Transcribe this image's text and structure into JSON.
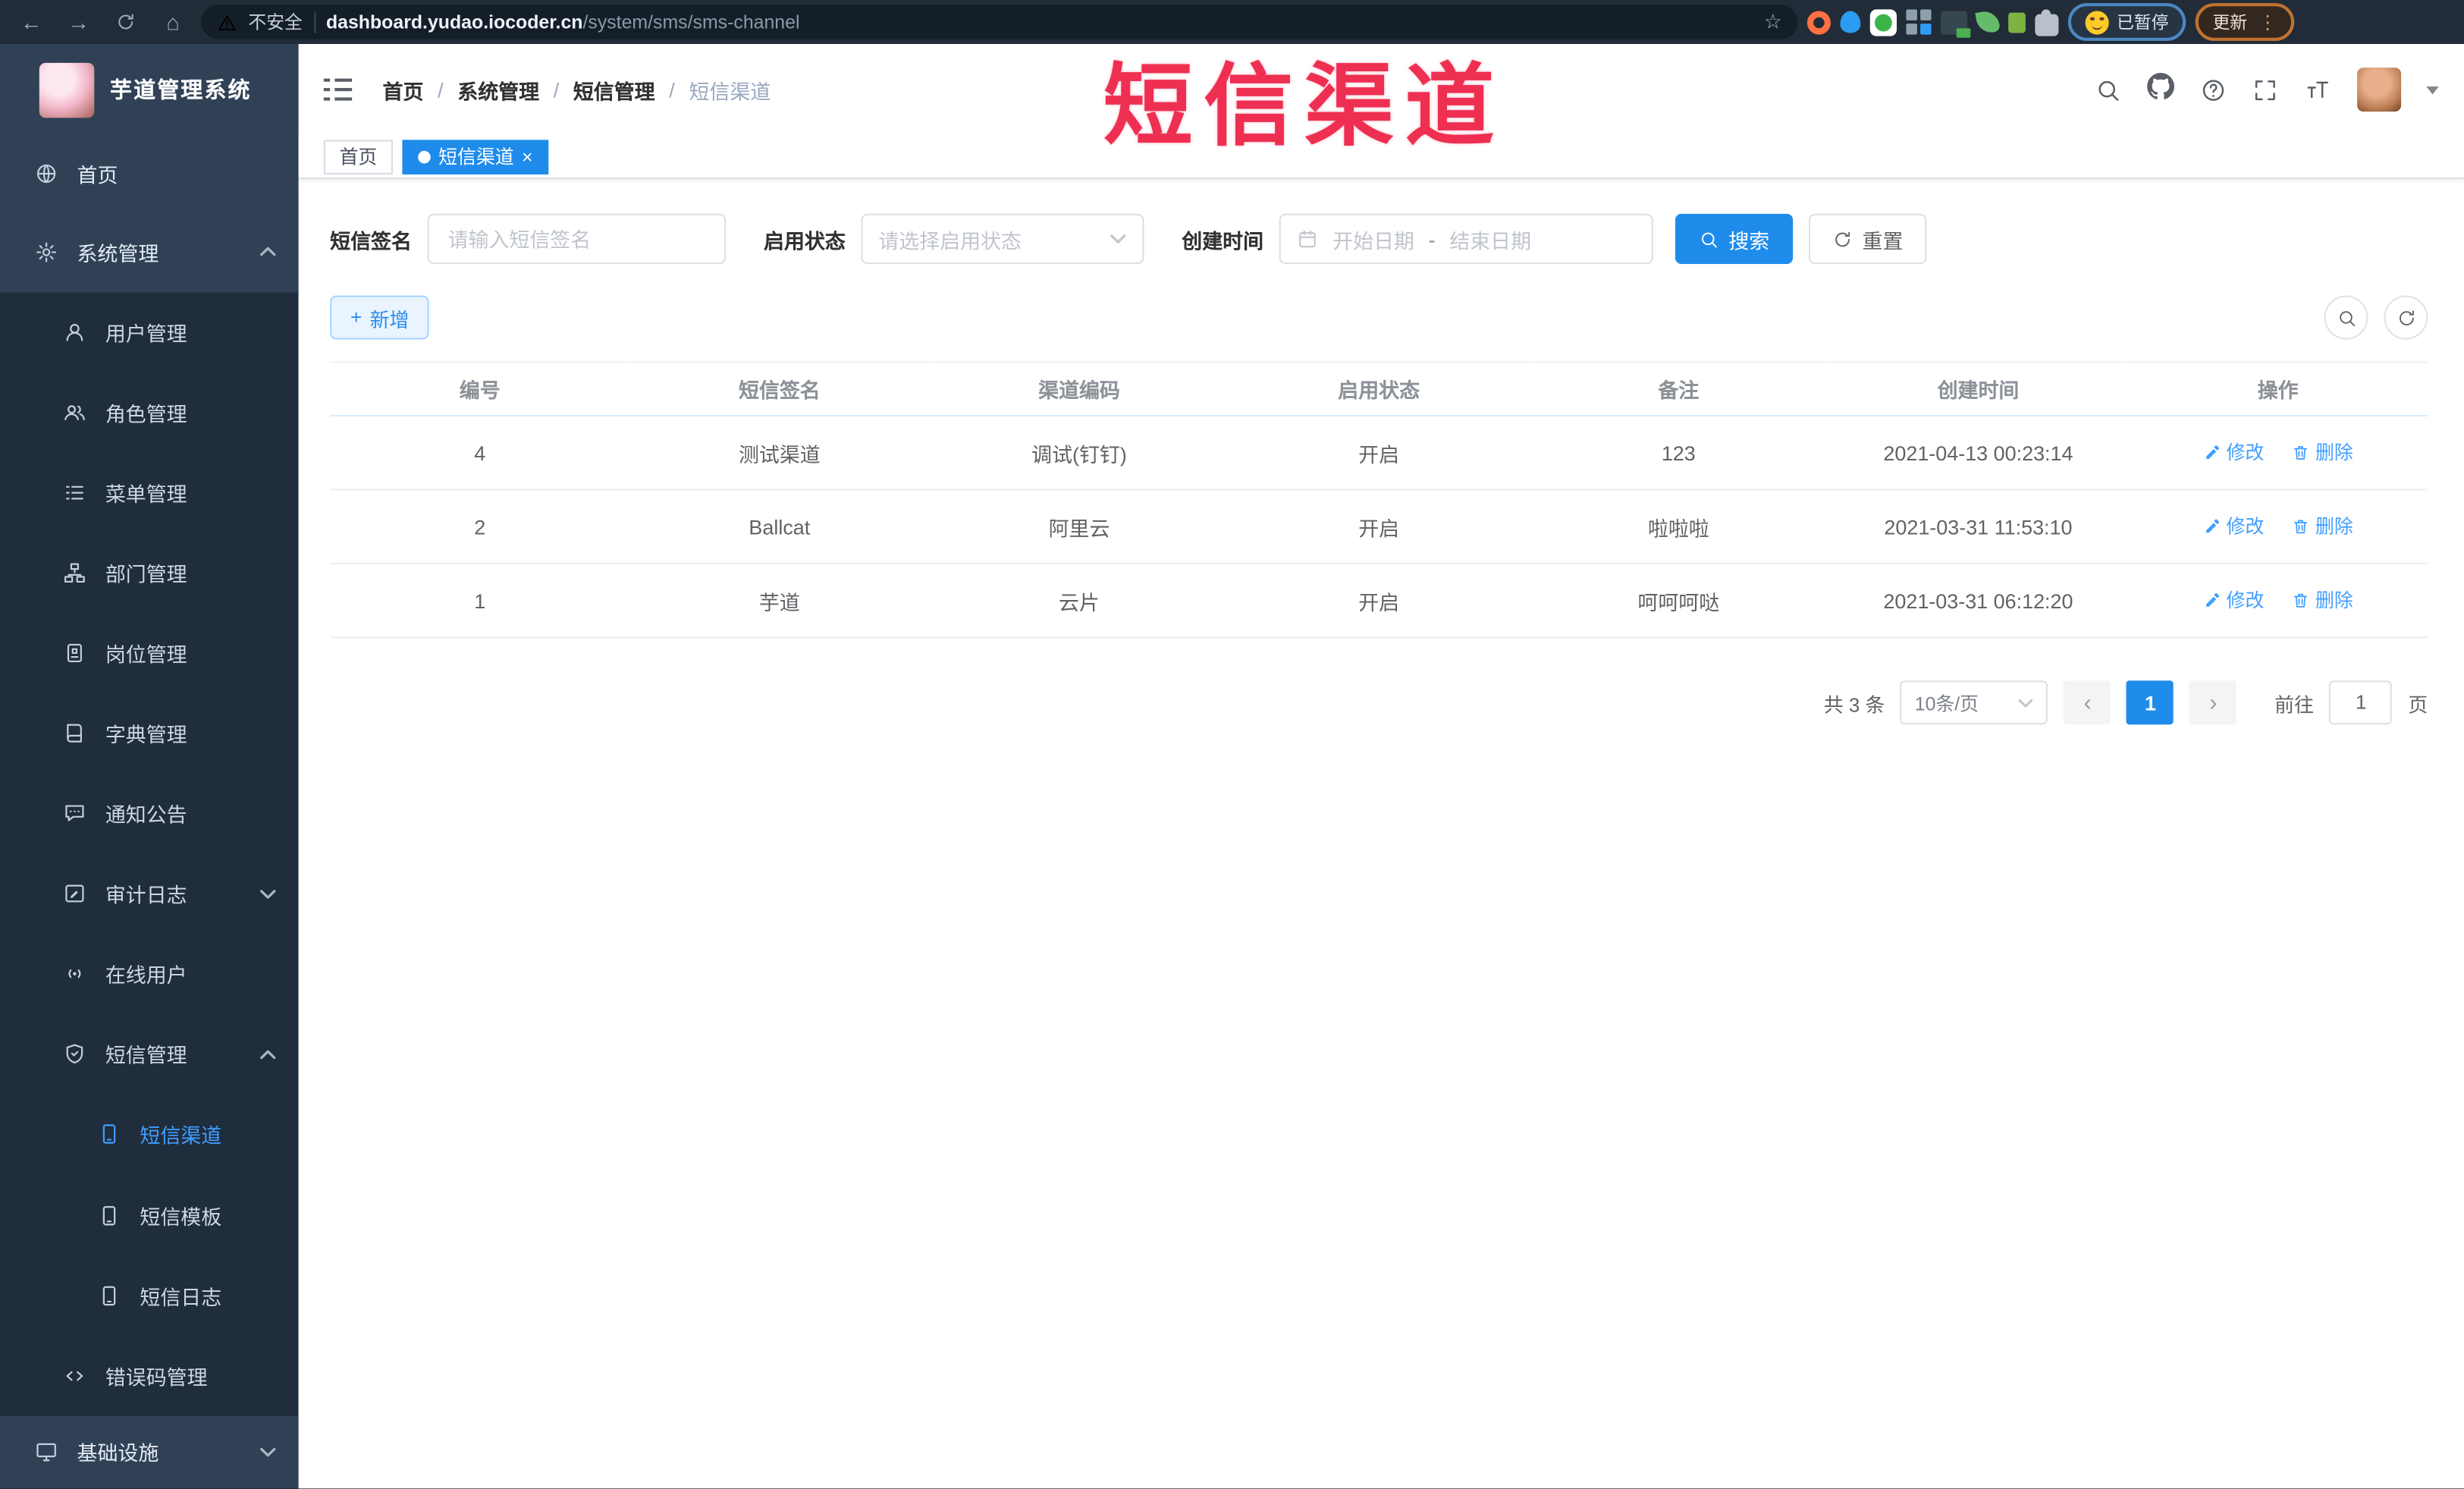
{
  "browser": {
    "security_warning": "不安全",
    "url_domain": "dashboard.yudao.iocoder.cn",
    "url_path": "/system/sms/sms-channel",
    "profile_label": "已暂停",
    "update_label": "更新"
  },
  "icons": {
    "back_arrow": "←",
    "forward_arrow": "→",
    "home": "⌂",
    "bookmark_star": "☆",
    "kebab": "⋮",
    "plus": "+",
    "close": "×",
    "prev": "‹",
    "next": "›"
  },
  "overlay_title": "短信渠道",
  "sidebar": {
    "logo_title": "芋道管理系统",
    "items": [
      {
        "label": "首页"
      },
      {
        "label": "系统管理"
      },
      {
        "label": "用户管理"
      },
      {
        "label": "角色管理"
      },
      {
        "label": "菜单管理"
      },
      {
        "label": "部门管理"
      },
      {
        "label": "岗位管理"
      },
      {
        "label": "字典管理"
      },
      {
        "label": "通知公告"
      },
      {
        "label": "审计日志"
      },
      {
        "label": "在线用户"
      },
      {
        "label": "短信管理"
      },
      {
        "label": "短信渠道"
      },
      {
        "label": "短信模板"
      },
      {
        "label": "短信日志"
      },
      {
        "label": "错误码管理"
      },
      {
        "label": "基础设施"
      }
    ]
  },
  "breadcrumb": {
    "separator": "/",
    "items": [
      "首页",
      "系统管理",
      "短信管理",
      "短信渠道"
    ]
  },
  "tabs": {
    "home": "首页",
    "current": "短信渠道"
  },
  "filters": {
    "signature_label": "短信签名",
    "signature_placeholder": "请输入短信签名",
    "status_label": "启用状态",
    "status_placeholder": "请选择启用状态",
    "time_label": "创建时间",
    "start_placeholder": "开始日期",
    "range_separator": "-",
    "end_placeholder": "结束日期",
    "search_label": "搜索",
    "reset_label": "重置"
  },
  "toolbar": {
    "add_label": "新增"
  },
  "table": {
    "headers": [
      "编号",
      "短信签名",
      "渠道编码",
      "启用状态",
      "备注",
      "创建时间",
      "操作"
    ],
    "edit_label": "修改",
    "delete_label": "删除",
    "rows": [
      {
        "id": "4",
        "signature": "测试渠道",
        "code": "调试(钉钉)",
        "status": "开启",
        "remark": "123",
        "created": "2021-04-13 00:23:14"
      },
      {
        "id": "2",
        "signature": "Ballcat",
        "code": "阿里云",
        "status": "开启",
        "remark": "啦啦啦",
        "created": "2021-03-31 11:53:10"
      },
      {
        "id": "1",
        "signature": "芋道",
        "code": "云片",
        "status": "开启",
        "remark": "呵呵呵哒",
        "created": "2021-03-31 06:12:20"
      }
    ]
  },
  "pagination": {
    "total_text": "共 3 条",
    "page_size": "10条/页",
    "current_page": "1",
    "goto_label": "前往",
    "goto_value": "1",
    "page_unit": "页"
  },
  "colors": {
    "accent_blue": "#1f8ceb",
    "link_blue": "#409eff",
    "title_red": "#ee2f52",
    "sidebar_bg": "#304156",
    "submenu_bg": "#1f2d3d",
    "chrome_bg": "#212c38"
  }
}
